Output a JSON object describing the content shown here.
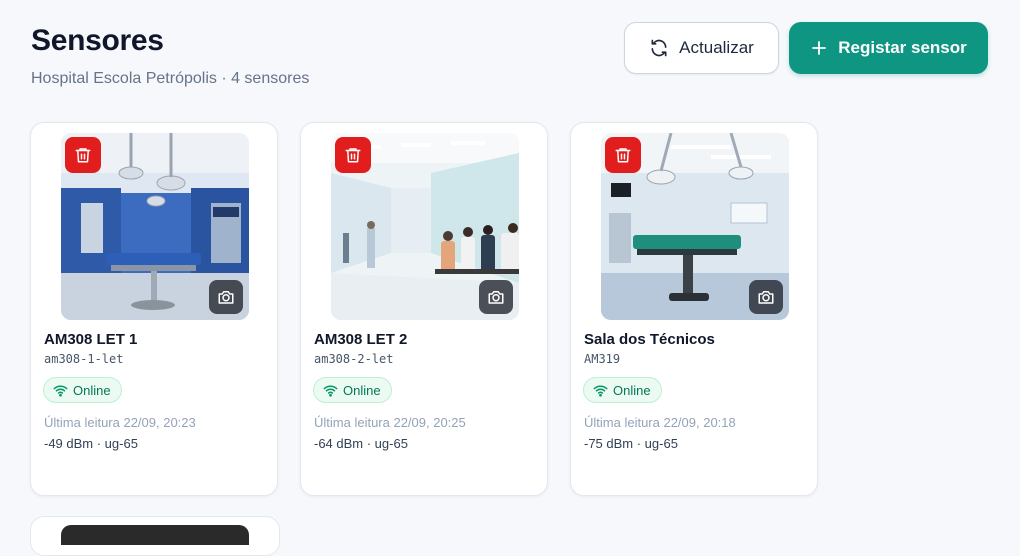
{
  "header": {
    "title": "Sensores",
    "subtitle": "Hospital Escola Petrópolis · 4 sensores",
    "refresh_label": "Actualizar",
    "add_label": "Registar sensor"
  },
  "colors": {
    "accent": "#0f9683",
    "delete": "#e11d1d",
    "online": "#047857"
  },
  "icons": {
    "refresh": "refresh-icon",
    "add": "plus-icon",
    "delete": "trash-icon",
    "camera": "camera-icon",
    "wifi": "wifi-icon"
  },
  "sensors": [
    {
      "name": "AM308 LET 1",
      "code": "am308-1-let",
      "status": "Online",
      "last_reading": "Última leitura 22/09, 20:23",
      "meta": "-49 dBm · ug-65",
      "image": "Operating room with blue walls and surgical lights"
    },
    {
      "name": "AM308 LET 2",
      "code": "am308-2-let",
      "status": "Online",
      "last_reading": "Última leitura 22/09, 20:25",
      "meta": "-64 dBm · ug-65",
      "image": "Hospital corridor with people waiting"
    },
    {
      "name": "Sala dos Técnicos",
      "code": "AM319",
      "status": "Online",
      "last_reading": "Última leitura 22/09, 20:18",
      "meta": "-75 dBm · ug-65",
      "image": "Operating room with green surgical table"
    }
  ]
}
